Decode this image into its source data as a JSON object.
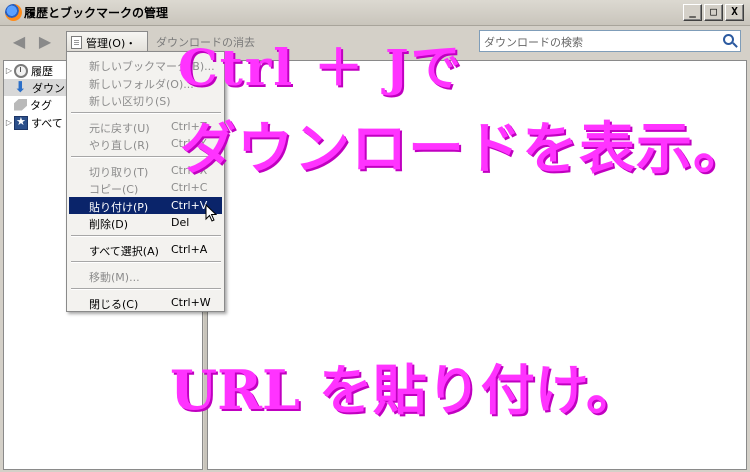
{
  "window": {
    "title": "履歴とブックマークの管理",
    "buttons": {
      "minimize": "_",
      "maximize": "□",
      "close": "X"
    }
  },
  "toolbar": {
    "back_label": "◀",
    "forward_label": "▶",
    "manage_label": "管理(O)・",
    "clear_downloads_label": "ダウンロードの消去",
    "search_placeholder": "ダウンロードの検索"
  },
  "tree": {
    "items": [
      {
        "label": "履歴",
        "icon": "clock-icon"
      },
      {
        "label": "ダウン",
        "icon": "download-icon",
        "selected": true
      },
      {
        "label": "タグ",
        "icon": "tag-icon"
      },
      {
        "label": "すべて",
        "icon": "bookmarks-star-icon"
      }
    ]
  },
  "menu": {
    "groups": [
      [
        {
          "label": "新しいブックマーク(B)...",
          "shortcut": "",
          "enabled": false
        },
        {
          "label": "新しいフォルダ(O)...",
          "shortcut": "",
          "enabled": false
        },
        {
          "label": "新しい区切り(S)",
          "shortcut": "",
          "enabled": false
        }
      ],
      [
        {
          "label": "元に戻す(U)",
          "shortcut": "Ctrl+Z",
          "enabled": false
        },
        {
          "label": "やり直し(R)",
          "shortcut": "Ctrl+Y",
          "enabled": false
        }
      ],
      [
        {
          "label": "切り取り(T)",
          "shortcut": "Ctrl+X",
          "enabled": false
        },
        {
          "label": "コピー(C)",
          "shortcut": "Ctrl+C",
          "enabled": false
        },
        {
          "label": "貼り付け(P)",
          "shortcut": "Ctrl+V",
          "enabled": true,
          "highlighted": true
        },
        {
          "label": "削除(D)",
          "shortcut": "Del",
          "enabled": true
        }
      ],
      [
        {
          "label": "すべて選択(A)",
          "shortcut": "Ctrl+A",
          "enabled": true
        }
      ],
      [
        {
          "label": "移動(M)...",
          "shortcut": "",
          "enabled": false
        }
      ],
      [
        {
          "label": "閉じる(C)",
          "shortcut": "Ctrl+W",
          "enabled": true
        }
      ]
    ]
  },
  "annotations": {
    "line1": "Ctrl ＋ Jで",
    "line2": "ダウンロードを表示。",
    "line3": "URL を貼り付け。"
  },
  "colors": {
    "annotation": "#ff33ff",
    "menu_highlight": "#0a246a"
  }
}
